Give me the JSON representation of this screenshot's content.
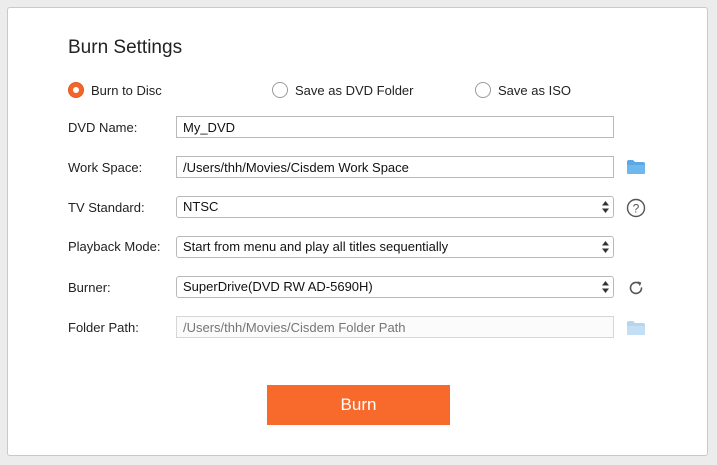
{
  "title": "Burn Settings",
  "output_options": [
    {
      "label": "Burn to Disc",
      "selected": true
    },
    {
      "label": "Save as DVD Folder",
      "selected": false
    },
    {
      "label": "Save as ISO",
      "selected": false
    }
  ],
  "dvd_name": {
    "label": "DVD Name:",
    "value": "My_DVD"
  },
  "work_space": {
    "label": "Work Space:",
    "value": "/Users/thh/Movies/Cisdem Work Space",
    "icon": "folder-icon"
  },
  "tv_standard": {
    "label": "TV Standard:",
    "value": "NTSC",
    "icon": "help-icon"
  },
  "playback_mode": {
    "label": "Playback  Mode:",
    "value": "Start from menu and play all titles sequentially"
  },
  "burner": {
    "label": "Burner:",
    "value": "SuperDrive(DVD RW AD-5690H)",
    "icon": "refresh-icon"
  },
  "folder_path": {
    "label": "Folder  Path:",
    "placeholder": "/Users/thh/Movies/Cisdem Folder Path",
    "enabled": false,
    "icon": "folder-icon"
  },
  "burn_button": "Burn",
  "colors": {
    "accent": "#f76a2c",
    "folder": "#5aa9e6",
    "folder_disabled": "#c4def3"
  }
}
